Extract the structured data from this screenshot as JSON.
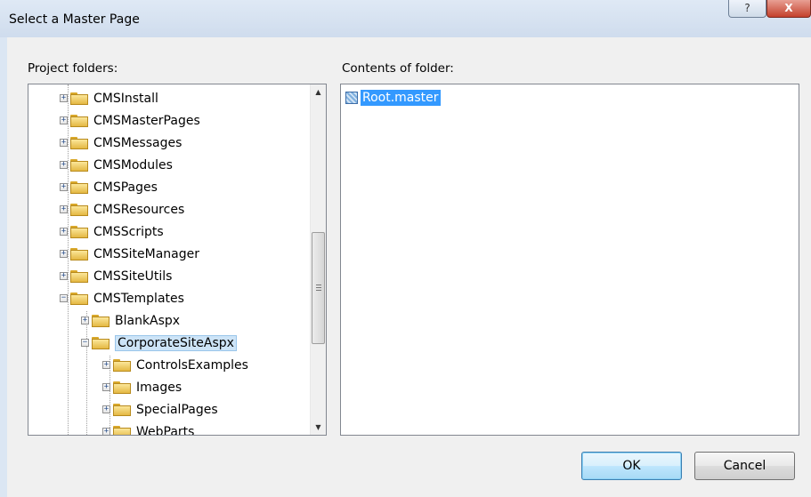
{
  "window": {
    "title": "Select a Master Page",
    "help_glyph": "?",
    "close_glyph": "X"
  },
  "left_panel": {
    "label": "Project folders:",
    "items": [
      {
        "label": "CMSInstall",
        "expander": "+"
      },
      {
        "label": "CMSMasterPages",
        "expander": "+"
      },
      {
        "label": "CMSMessages",
        "expander": "+"
      },
      {
        "label": "CMSModules",
        "expander": "+"
      },
      {
        "label": "CMSPages",
        "expander": "+"
      },
      {
        "label": "CMSResources",
        "expander": "+"
      },
      {
        "label": "CMSScripts",
        "expander": "+"
      },
      {
        "label": "CMSSiteManager",
        "expander": "+"
      },
      {
        "label": "CMSSiteUtils",
        "expander": "+"
      },
      {
        "label": "CMSTemplates",
        "expander": "−"
      },
      {
        "label": "BlankAspx",
        "expander": "+"
      },
      {
        "label": "CorporateSiteAspx",
        "expander": "−"
      },
      {
        "label": "ControlsExamples",
        "expander": "+"
      },
      {
        "label": "Images",
        "expander": "+"
      },
      {
        "label": "SpecialPages",
        "expander": "+"
      },
      {
        "label": "WebParts",
        "expander": "+"
      }
    ],
    "scroll_up": "▲",
    "scroll_down": "▼"
  },
  "right_panel": {
    "label": "Contents of folder:",
    "files": [
      {
        "label": "Root.master"
      }
    ]
  },
  "buttons": {
    "ok": "OK",
    "cancel": "Cancel"
  }
}
